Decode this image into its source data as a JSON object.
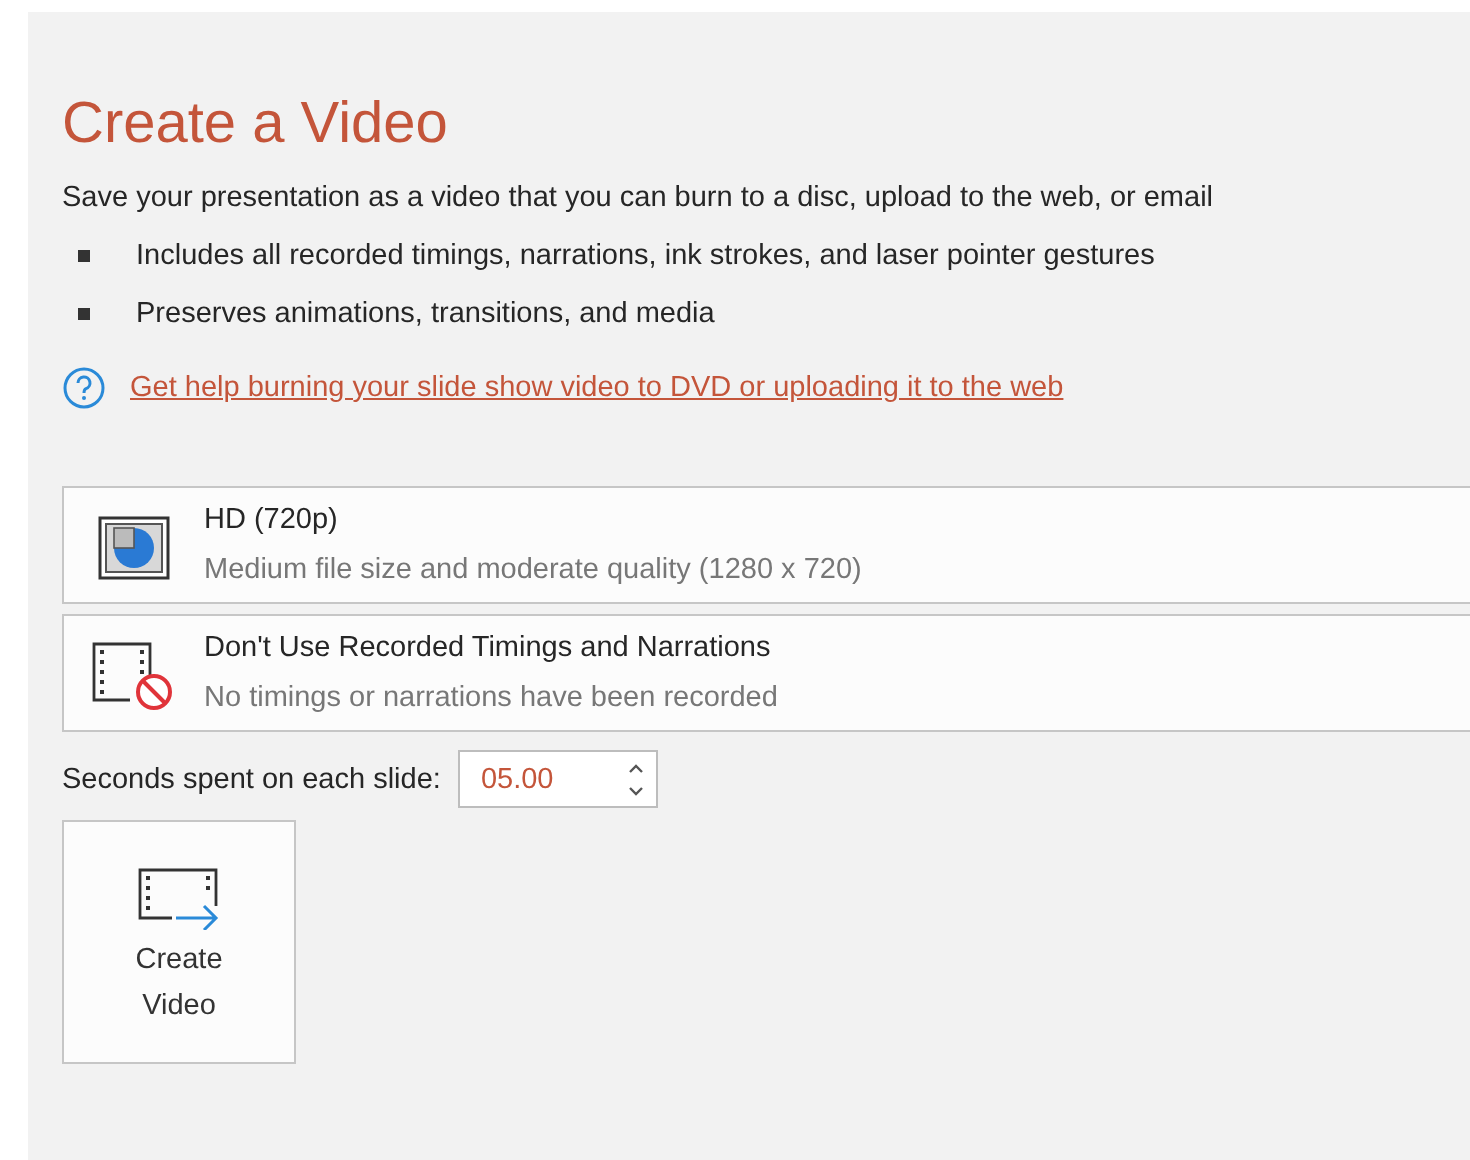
{
  "title": "Create a Video",
  "description": "Save your presentation as a video that you can burn to a disc, upload to the web, or email",
  "bullets": [
    "Includes all recorded timings, narrations, ink strokes, and laser pointer gestures",
    "Preserves animations, transitions, and media"
  ],
  "help_link": "Get help burning your slide show video to DVD or uploading it to the web",
  "options": [
    {
      "kind": "quality",
      "title": "HD (720p)",
      "subtitle": "Medium file size and moderate quality (1280 x 720)"
    },
    {
      "kind": "timings",
      "title": "Don't Use Recorded Timings and Narrations",
      "subtitle": "No timings or narrations have been recorded"
    }
  ],
  "seconds": {
    "label": "Seconds spent on each slide:",
    "value": "05.00"
  },
  "create_button": "Create\nVideo"
}
